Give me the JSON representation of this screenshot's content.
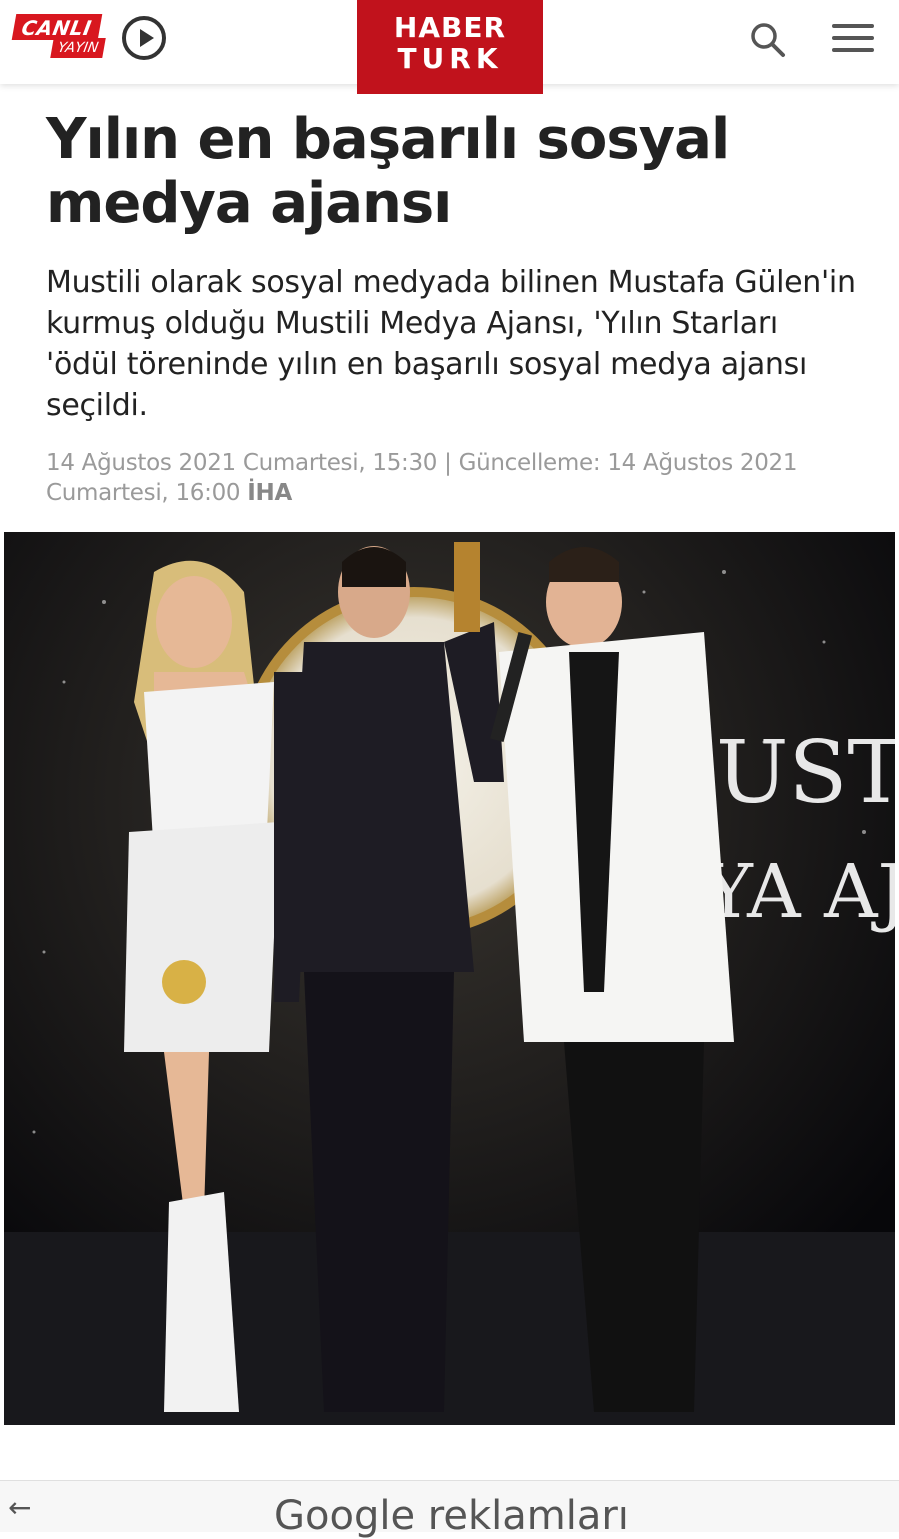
{
  "header": {
    "live_top": "CANLI",
    "live_bottom": "YAYIN",
    "logo_top": "HABER",
    "logo_bottom": "TURK"
  },
  "article": {
    "title": "Yılın en başarılı sosyal medya ajansı",
    "summary": "Mustili olarak sosyal medyada bilinen Mustafa Gülen'in kurmuş olduğu Mustili Medya Ajansı, 'Yılın Starları 'ödül töreninde yılın en başarılı sosyal medya ajansı seçildi.",
    "date": "14 Ağustos 2021 Cumartesi, 15:30 | Güncelleme: 14 Ağustos 2021 Cumartesi, 16:00",
    "source": "İHA",
    "photo_text_1": "USTİLİ",
    "photo_text_2": "YA AJAN"
  },
  "ad": {
    "label": "Google reklamları"
  },
  "colors": {
    "brand_red": "#c1121c",
    "live_red": "#d8171f"
  },
  "icons": [
    "play-icon",
    "search-icon",
    "menu-icon",
    "back-arrow-icon"
  ]
}
